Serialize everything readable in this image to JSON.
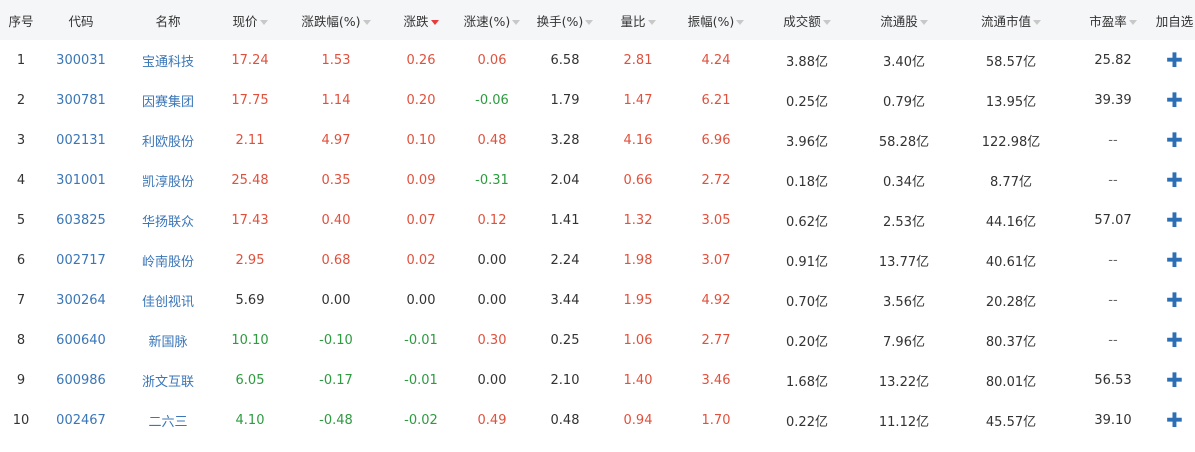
{
  "header": {
    "columns": [
      {
        "label": "序号",
        "sort": "none"
      },
      {
        "label": "代码",
        "sort": "none"
      },
      {
        "label": "名称",
        "sort": "none"
      },
      {
        "label": "现价",
        "sort": "inactive"
      },
      {
        "label": "涨跌幅(%)",
        "sort": "inactive"
      },
      {
        "label": "涨跌",
        "sort": "active"
      },
      {
        "label": "涨速(%)",
        "sort": "inactive"
      },
      {
        "label": "换手(%)",
        "sort": "inactive"
      },
      {
        "label": "量比",
        "sort": "inactive"
      },
      {
        "label": "振幅(%)",
        "sort": "inactive"
      },
      {
        "label": "成交额",
        "sort": "inactive"
      },
      {
        "label": "流通股",
        "sort": "inactive"
      },
      {
        "label": "流通市值",
        "sort": "inactive"
      },
      {
        "label": "市盈率",
        "sort": "inactive"
      },
      {
        "label": "加自选",
        "sort": "none"
      }
    ]
  },
  "colors": {
    "up": "#e0513d",
    "down": "#2d9b3f",
    "link": "#3a76b8",
    "add_icon": "#2c6fb5",
    "sort_active": "#e83b3b",
    "sort_inactive": "#c8c8c8"
  },
  "add_icon": "plus-icon",
  "rows": [
    {
      "index": "1",
      "code": "300031",
      "name": "宝通科技",
      "price": "17.24",
      "change_pct": "1.53",
      "change": "0.26",
      "speed": "0.06",
      "turnover": "6.58",
      "volume_ratio": "2.81",
      "amplitude": "4.24",
      "amount": "3.88亿",
      "float_shares": "3.40亿",
      "float_cap": "58.57亿",
      "pe": "25.82"
    },
    {
      "index": "2",
      "code": "300781",
      "name": "因赛集团",
      "price": "17.75",
      "change_pct": "1.14",
      "change": "0.20",
      "speed": "-0.06",
      "turnover": "1.79",
      "volume_ratio": "1.47",
      "amplitude": "6.21",
      "amount": "0.25亿",
      "float_shares": "0.79亿",
      "float_cap": "13.95亿",
      "pe": "39.39"
    },
    {
      "index": "3",
      "code": "002131",
      "name": "利欧股份",
      "price": "2.11",
      "change_pct": "4.97",
      "change": "0.10",
      "speed": "0.48",
      "turnover": "3.28",
      "volume_ratio": "4.16",
      "amplitude": "6.96",
      "amount": "3.96亿",
      "float_shares": "58.28亿",
      "float_cap": "122.98亿",
      "pe": "--"
    },
    {
      "index": "4",
      "code": "301001",
      "name": "凯淳股份",
      "price": "25.48",
      "change_pct": "0.35",
      "change": "0.09",
      "speed": "-0.31",
      "turnover": "2.04",
      "volume_ratio": "0.66",
      "amplitude": "2.72",
      "amount": "0.18亿",
      "float_shares": "0.34亿",
      "float_cap": "8.77亿",
      "pe": "--"
    },
    {
      "index": "5",
      "code": "603825",
      "name": "华扬联众",
      "price": "17.43",
      "change_pct": "0.40",
      "change": "0.07",
      "speed": "0.12",
      "turnover": "1.41",
      "volume_ratio": "1.32",
      "amplitude": "3.05",
      "amount": "0.62亿",
      "float_shares": "2.53亿",
      "float_cap": "44.16亿",
      "pe": "57.07"
    },
    {
      "index": "6",
      "code": "002717",
      "name": "岭南股份",
      "price": "2.95",
      "change_pct": "0.68",
      "change": "0.02",
      "speed": "0.00",
      "turnover": "2.24",
      "volume_ratio": "1.98",
      "amplitude": "3.07",
      "amount": "0.91亿",
      "float_shares": "13.77亿",
      "float_cap": "40.61亿",
      "pe": "--"
    },
    {
      "index": "7",
      "code": "300264",
      "name": "佳创视讯",
      "price": "5.69",
      "change_pct": "0.00",
      "change": "0.00",
      "speed": "0.00",
      "turnover": "3.44",
      "volume_ratio": "1.95",
      "amplitude": "4.92",
      "amount": "0.70亿",
      "float_shares": "3.56亿",
      "float_cap": "20.28亿",
      "pe": "--"
    },
    {
      "index": "8",
      "code": "600640",
      "name": "新国脉",
      "price": "10.10",
      "change_pct": "-0.10",
      "change": "-0.01",
      "speed": "0.30",
      "turnover": "0.25",
      "volume_ratio": "1.06",
      "amplitude": "2.77",
      "amount": "0.20亿",
      "float_shares": "7.96亿",
      "float_cap": "80.37亿",
      "pe": "--"
    },
    {
      "index": "9",
      "code": "600986",
      "name": "浙文互联",
      "price": "6.05",
      "change_pct": "-0.17",
      "change": "-0.01",
      "speed": "0.00",
      "turnover": "2.10",
      "volume_ratio": "1.40",
      "amplitude": "3.46",
      "amount": "1.68亿",
      "float_shares": "13.22亿",
      "float_cap": "80.01亿",
      "pe": "56.53"
    },
    {
      "index": "10",
      "code": "002467",
      "name": "二六三",
      "price": "4.10",
      "change_pct": "-0.48",
      "change": "-0.02",
      "speed": "0.49",
      "turnover": "0.48",
      "volume_ratio": "0.94",
      "amplitude": "1.70",
      "amount": "0.22亿",
      "float_shares": "11.12亿",
      "float_cap": "45.57亿",
      "pe": "39.10"
    }
  ]
}
